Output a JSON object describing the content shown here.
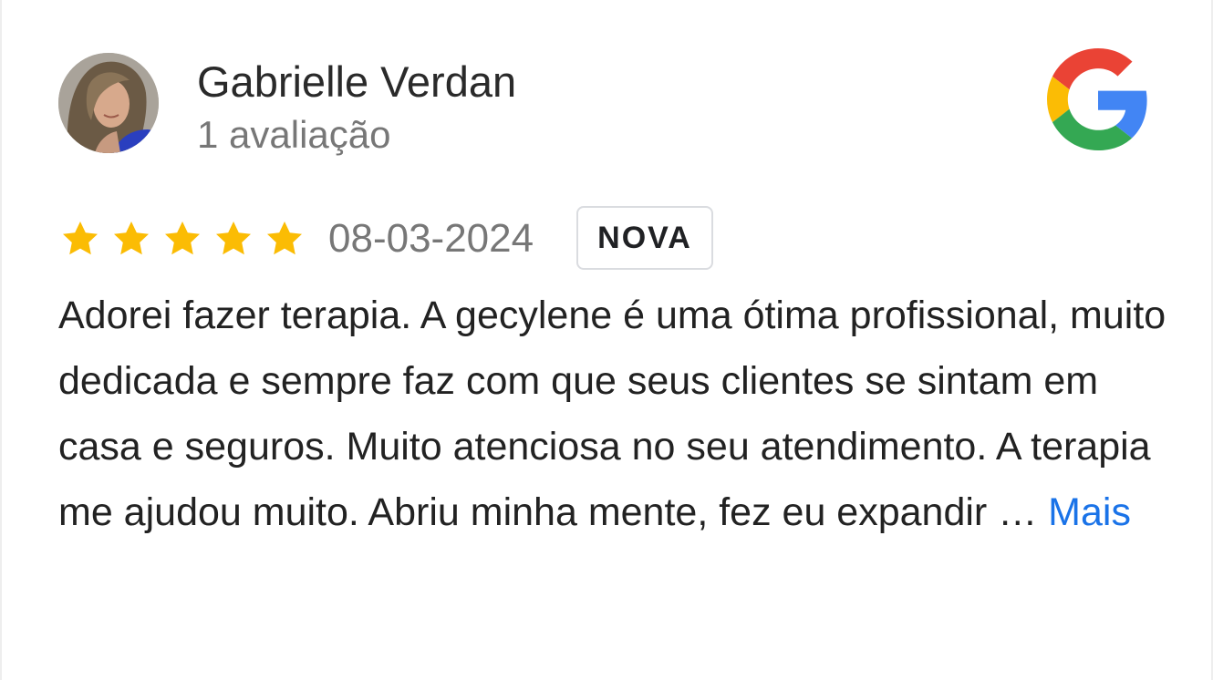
{
  "reviewer": {
    "name": "Gabrielle Verdan",
    "review_count": "1 avaliação",
    "avatar_icon": "user-photo"
  },
  "logo": {
    "icon": "google-g-logo",
    "colors": [
      "#4285F4",
      "#EA4335",
      "#FBBC05",
      "#34A853"
    ]
  },
  "rating": {
    "stars": 5,
    "max_stars": 5,
    "star_color": "#FBBC04"
  },
  "review": {
    "date": "08-03-2024",
    "badge": "NOVA",
    "text": "Adorei fazer terapia. A gecylene é uma ótima profissional, muito dedicada e sempre faz com que seus clientes se sintam em casa e seguros. Muito atenciosa no seu atendimento. A terapia me ajudou muito. Abriu minha mente, fez eu expandir …",
    "more_label": "Mais",
    "more_color": "#1a73e8"
  }
}
